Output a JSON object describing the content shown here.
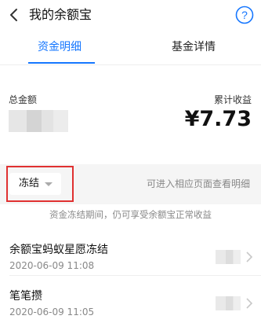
{
  "header": {
    "title": "我的余额宝",
    "back_icon": "chevron-left-icon",
    "help_icon": "question-circle-icon",
    "accent_color": "#1677ff"
  },
  "tabs": [
    {
      "label": "资金明细",
      "active": true
    },
    {
      "label": "基金详情",
      "active": false
    }
  ],
  "summary": {
    "total_label": "总金额",
    "income_label": "累计收益",
    "income_value": "¥7.73"
  },
  "filter": {
    "selected": "冻结",
    "hint": "可进入相应页面查看明细"
  },
  "notice": "资金冻结期间，仍可享受余额宝正常收益",
  "items": [
    {
      "title": "余额宝蚂蚁星愿冻结",
      "time": "2020-06-09 11:08"
    },
    {
      "title": "笔笔攒",
      "time": "2020-06-09 11:05"
    }
  ]
}
